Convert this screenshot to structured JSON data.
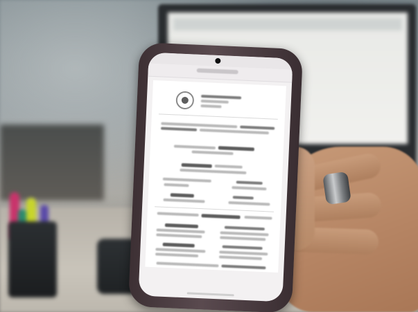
{
  "scene": {
    "description_tags": [
      "smartphone",
      "hand",
      "monitor",
      "desk",
      "pens"
    ]
  },
  "phone": {
    "status_time": "",
    "status_icons": "",
    "nav_back": "",
    "nav_menu": "",
    "bottom_nav": [
      "",
      "",
      "",
      "",
      "",
      ""
    ]
  }
}
